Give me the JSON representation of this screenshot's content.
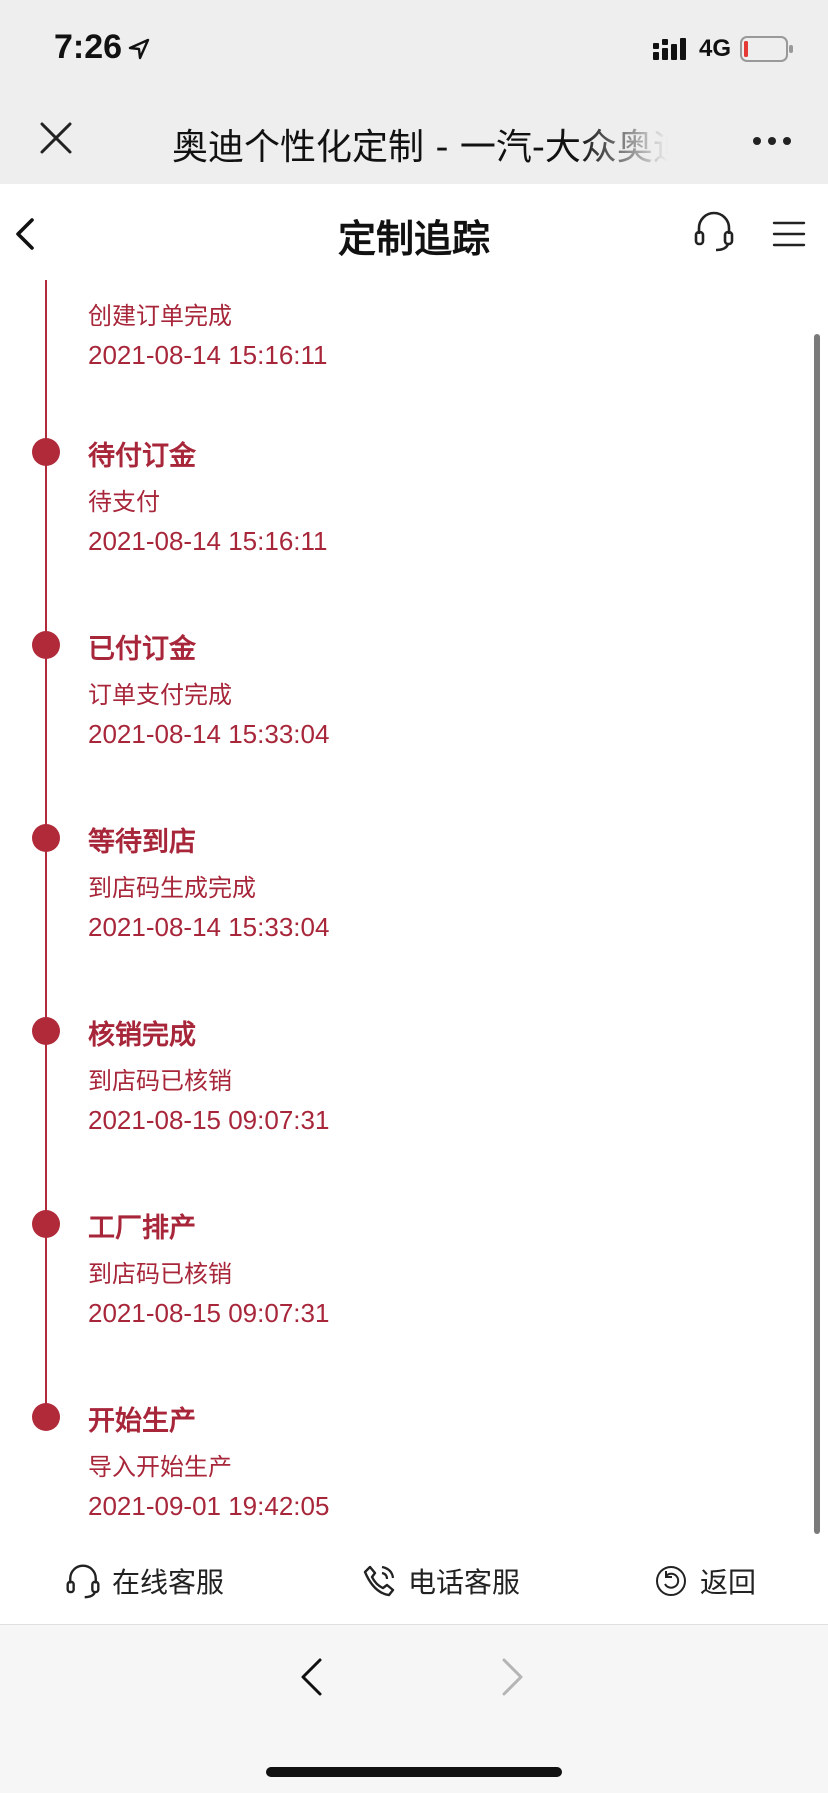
{
  "status": {
    "time": "7:26",
    "network": "4G"
  },
  "wechat": {
    "title": "奥迪个性化定制 - 一汽-大众奥迪"
  },
  "header": {
    "title": "定制追踪"
  },
  "timeline": {
    "partial_item": {
      "desc": "创建订单完成",
      "time": "2021-08-14 15:16:11"
    },
    "items": [
      {
        "title": "待付订金",
        "desc": "待支付",
        "time": "2021-08-14 15:16:11"
      },
      {
        "title": "已付订金",
        "desc": "订单支付完成",
        "time": "2021-08-14 15:33:04"
      },
      {
        "title": "等待到店",
        "desc": "到店码生成完成",
        "time": "2021-08-14 15:33:04"
      },
      {
        "title": "核销完成",
        "desc": "到店码已核销",
        "time": "2021-08-15 09:07:31"
      },
      {
        "title": "工厂排产",
        "desc": "到店码已核销",
        "time": "2021-08-15 09:07:31"
      },
      {
        "title": "开始生产",
        "desc": "导入开始生产",
        "time": "2021-09-01 19:42:05"
      }
    ]
  },
  "service_bar": {
    "online": "在线客服",
    "phone": "电话客服",
    "back": "返回"
  },
  "colors": {
    "accent": "#b02a3a",
    "text_accent": "#a8263a"
  }
}
